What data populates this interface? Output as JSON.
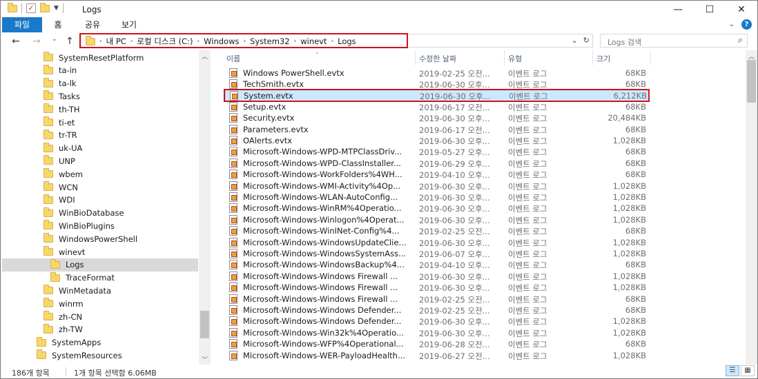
{
  "window": {
    "title": "Logs",
    "minimize": "—",
    "maximize": "☐",
    "close": "✕"
  },
  "ribbon": {
    "tabs": [
      "파일",
      "홈",
      "공유",
      "보기"
    ]
  },
  "address": {
    "crumbs": [
      "내 PC",
      "로컬 디스크 (C:)",
      "Windows",
      "System32",
      "winevt",
      "Logs"
    ],
    "search_placeholder": "Logs 검색"
  },
  "nav": {
    "items": [
      {
        "label": "SystemResetPlatform",
        "depth": 1,
        "selected": false
      },
      {
        "label": "ta-in",
        "depth": 1,
        "selected": false
      },
      {
        "label": "ta-lk",
        "depth": 1,
        "selected": false
      },
      {
        "label": "Tasks",
        "depth": 1,
        "selected": false
      },
      {
        "label": "th-TH",
        "depth": 1,
        "selected": false
      },
      {
        "label": "ti-et",
        "depth": 1,
        "selected": false
      },
      {
        "label": "tr-TR",
        "depth": 1,
        "selected": false
      },
      {
        "label": "uk-UA",
        "depth": 1,
        "selected": false
      },
      {
        "label": "UNP",
        "depth": 1,
        "selected": false
      },
      {
        "label": "wbem",
        "depth": 1,
        "selected": false
      },
      {
        "label": "WCN",
        "depth": 1,
        "selected": false
      },
      {
        "label": "WDI",
        "depth": 1,
        "selected": false
      },
      {
        "label": "WinBioDatabase",
        "depth": 1,
        "selected": false
      },
      {
        "label": "WinBioPlugins",
        "depth": 1,
        "selected": false
      },
      {
        "label": "WindowsPowerShell",
        "depth": 1,
        "selected": false
      },
      {
        "label": "winevt",
        "depth": 1,
        "selected": false
      },
      {
        "label": "Logs",
        "depth": 2,
        "selected": true
      },
      {
        "label": "TraceFormat",
        "depth": 2,
        "selected": false
      },
      {
        "label": "WinMetadata",
        "depth": 1,
        "selected": false
      },
      {
        "label": "winrm",
        "depth": 1,
        "selected": false
      },
      {
        "label": "zh-CN",
        "depth": 1,
        "selected": false
      },
      {
        "label": "zh-TW",
        "depth": 1,
        "selected": false
      },
      {
        "label": "SystemApps",
        "depth": 0,
        "selected": false
      },
      {
        "label": "SystemResources",
        "depth": 0,
        "selected": false
      }
    ]
  },
  "columns": {
    "name": "이름",
    "date": "수정한 날짜",
    "type": "유형",
    "size": "크기"
  },
  "files": [
    {
      "name": "Windows PowerShell.evtx",
      "date": "2019-02-25 오전...",
      "type": "이벤트 로그",
      "size": "68KB",
      "selected": false
    },
    {
      "name": "TechSmith.evtx",
      "date": "2019-06-30 오후...",
      "type": "이벤트 로그",
      "size": "68KB",
      "selected": false
    },
    {
      "name": "System.evtx",
      "date": "2019-06-30 오후...",
      "type": "이벤트 로그",
      "size": "6,212KB",
      "selected": true
    },
    {
      "name": "Setup.evtx",
      "date": "2019-06-17 오전...",
      "type": "이벤트 로그",
      "size": "68KB",
      "selected": false
    },
    {
      "name": "Security.evtx",
      "date": "2019-06-30 오후...",
      "type": "이벤트 로그",
      "size": "20,484KB",
      "selected": false
    },
    {
      "name": "Parameters.evtx",
      "date": "2019-06-17 오전...",
      "type": "이벤트 로그",
      "size": "68KB",
      "selected": false
    },
    {
      "name": "OAlerts.evtx",
      "date": "2019-06-30 오후...",
      "type": "이벤트 로그",
      "size": "1,028KB",
      "selected": false
    },
    {
      "name": "Microsoft-Windows-WPD-MTPClassDriv...",
      "date": "2019-05-27 오후...",
      "type": "이벤트 로그",
      "size": "68KB",
      "selected": false
    },
    {
      "name": "Microsoft-Windows-WPD-ClassInstaller...",
      "date": "2019-06-29 오후...",
      "type": "이벤트 로그",
      "size": "68KB",
      "selected": false
    },
    {
      "name": "Microsoft-Windows-WorkFolders%4WH...",
      "date": "2019-04-10 오후...",
      "type": "이벤트 로그",
      "size": "68KB",
      "selected": false
    },
    {
      "name": "Microsoft-Windows-WMI-Activity%4Op...",
      "date": "2019-06-30 오후...",
      "type": "이벤트 로그",
      "size": "1,028KB",
      "selected": false
    },
    {
      "name": "Microsoft-Windows-WLAN-AutoConfig...",
      "date": "2019-06-30 오후...",
      "type": "이벤트 로그",
      "size": "1,028KB",
      "selected": false
    },
    {
      "name": "Microsoft-Windows-WinRM%4Operatio...",
      "date": "2019-06-30 오후...",
      "type": "이벤트 로그",
      "size": "1,028KB",
      "selected": false
    },
    {
      "name": "Microsoft-Windows-Winlogon%4Operat...",
      "date": "2019-06-30 오후...",
      "type": "이벤트 로그",
      "size": "1,028KB",
      "selected": false
    },
    {
      "name": "Microsoft-Windows-WinINet-Config%4...",
      "date": "2019-02-25 오전...",
      "type": "이벤트 로그",
      "size": "68KB",
      "selected": false
    },
    {
      "name": "Microsoft-Windows-WindowsUpdateClie...",
      "date": "2019-06-30 오후...",
      "type": "이벤트 로그",
      "size": "1,028KB",
      "selected": false
    },
    {
      "name": "Microsoft-Windows-WindowsSystemAss...",
      "date": "2019-06-07 오후...",
      "type": "이벤트 로그",
      "size": "1,028KB",
      "selected": false
    },
    {
      "name": "Microsoft-Windows-WindowsBackup%4...",
      "date": "2019-04-10 오후...",
      "type": "이벤트 로그",
      "size": "68KB",
      "selected": false
    },
    {
      "name": "Microsoft-Windows-Windows Firewall ...",
      "date": "2019-06-30 오후...",
      "type": "이벤트 로그",
      "size": "1,028KB",
      "selected": false
    },
    {
      "name": "Microsoft-Windows-Windows Firewall ...",
      "date": "2019-06-30 오후...",
      "type": "이벤트 로그",
      "size": "1,028KB",
      "selected": false
    },
    {
      "name": "Microsoft-Windows-Windows Firewall ...",
      "date": "2019-02-25 오전...",
      "type": "이벤트 로그",
      "size": "68KB",
      "selected": false
    },
    {
      "name": "Microsoft-Windows-Windows Defender...",
      "date": "2019-02-25 오전...",
      "type": "이벤트 로그",
      "size": "68KB",
      "selected": false
    },
    {
      "name": "Microsoft-Windows-Windows Defender...",
      "date": "2019-06-30 오후...",
      "type": "이벤트 로그",
      "size": "1,028KB",
      "selected": false
    },
    {
      "name": "Microsoft-Windows-Win32k%4Operatio...",
      "date": "2019-06-30 오후...",
      "type": "이벤트 로그",
      "size": "1,028KB",
      "selected": false
    },
    {
      "name": "Microsoft-Windows-WFP%4Operational...",
      "date": "2019-06-28 오전...",
      "type": "이벤트 로그",
      "size": "68KB",
      "selected": false
    },
    {
      "name": "Microsoft-Windows-WER-PayloadHealth...",
      "date": "2019-06-27 오전...",
      "type": "이벤트 로그",
      "size": "1,028KB",
      "selected": false
    }
  ],
  "status": {
    "item_count": "186개 항목",
    "selection": "1개 항목 선택함 6.06MB"
  },
  "colors": {
    "accent": "#1979ca",
    "highlight_box": "#d0111b",
    "selection_bg": "#cce8ff"
  }
}
